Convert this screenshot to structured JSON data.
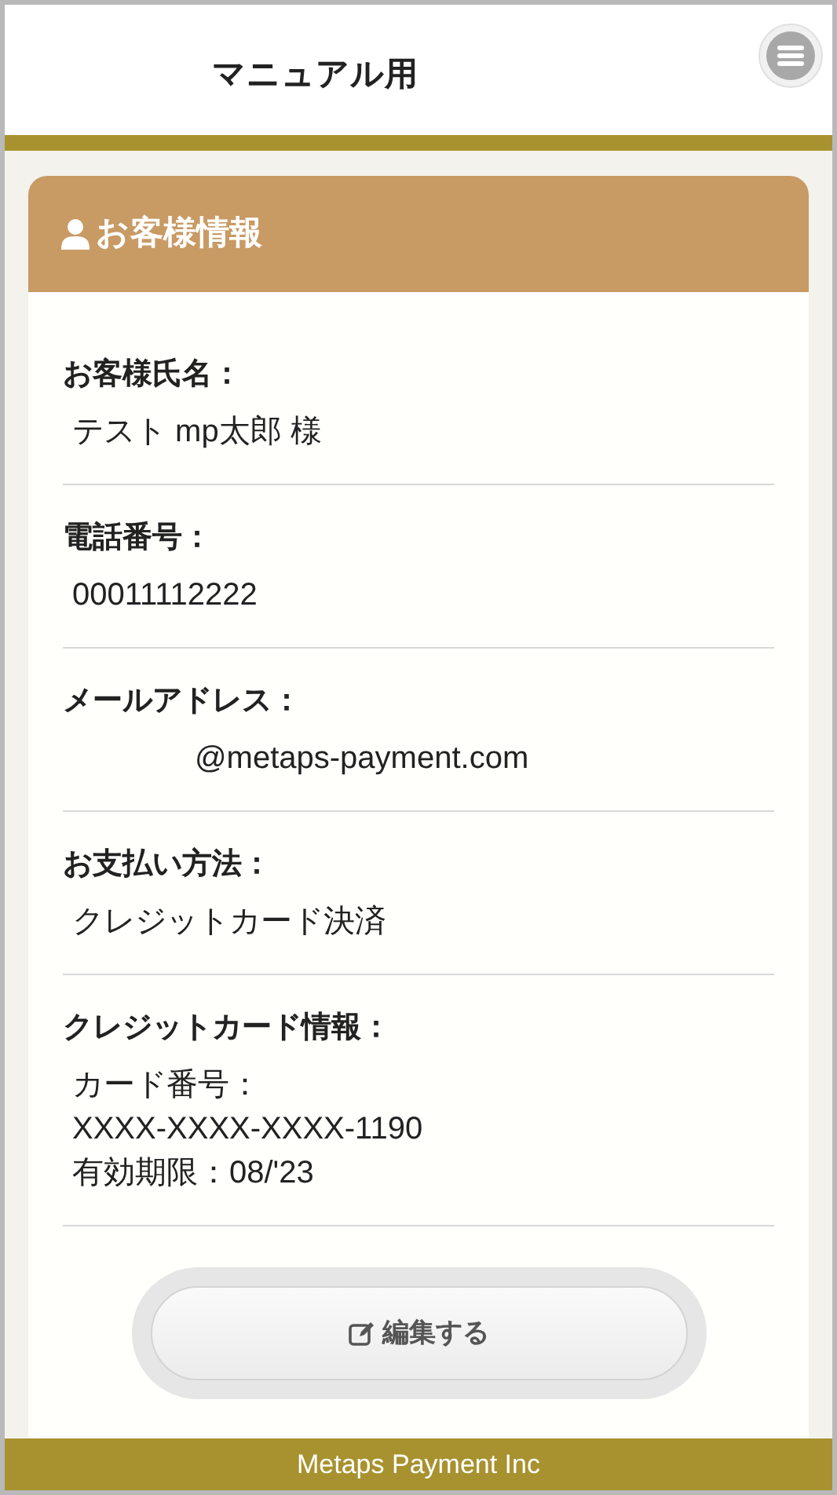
{
  "header": {
    "title": "マニュアル用"
  },
  "card": {
    "title": "お客様情報",
    "fields": [
      {
        "label": "お客様氏名：",
        "lines": [
          "テスト mp太郎 様"
        ],
        "redacted": false
      },
      {
        "label": "電話番号：",
        "lines": [
          "00011112222"
        ],
        "redacted": false
      },
      {
        "label": "メールアドレス：",
        "lines": [
          "@metaps-payment.com"
        ],
        "redacted": true
      },
      {
        "label": "お支払い方法：",
        "lines": [
          "クレジットカード決済"
        ],
        "redacted": false
      },
      {
        "label": "クレジットカード情報：",
        "lines": [
          "カード番号：",
          "XXXX-XXXX-XXXX-1190",
          "有効期限：08/'23"
        ],
        "redacted": false
      }
    ],
    "edit_button": "編集する"
  },
  "footer": "Metaps Payment Inc"
}
